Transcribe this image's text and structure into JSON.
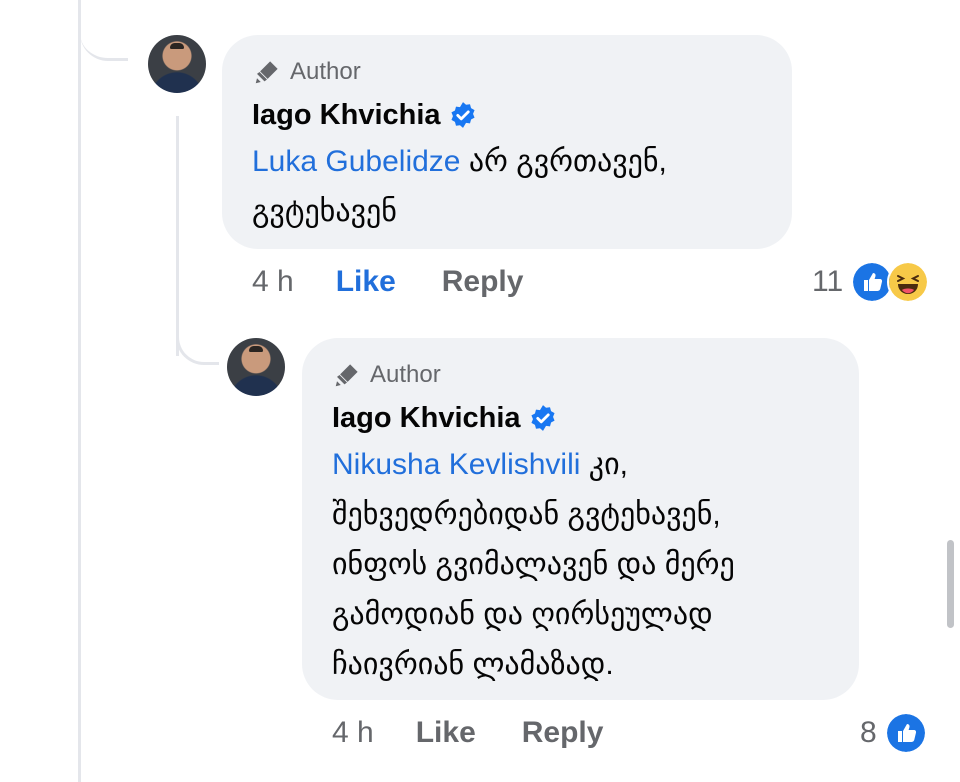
{
  "comments": [
    {
      "author_tag": "Author",
      "name": "Iago Khvichia",
      "mention": "Luka Gubelidze",
      "text_lines": [
        " არ გვრთავენ,",
        "გვტეხავენ"
      ],
      "time": "4 h",
      "like_label": "Like",
      "reply_label": "Reply",
      "reaction_count": "11",
      "reactions": [
        "like-icon",
        "haha-icon"
      ]
    },
    {
      "author_tag": "Author",
      "name": "Iago Khvichia",
      "mention": "Nikusha Kevlishvili",
      "text_lines": [
        " კი,",
        "შეხვედრებიდან გვტეხავენ,",
        "ინფოს გვიმალავენ და მერე",
        "გამოდიან და ღირსეულად",
        "ჩაივრიან ლამაზად."
      ],
      "time": "4 h",
      "like_label": "Like",
      "reply_label": "Reply",
      "reaction_count": "8",
      "reactions": [
        "like-icon"
      ]
    }
  ],
  "colors": {
    "link": "#216fdb",
    "bubble": "#f0f2f5",
    "meta": "#65676b"
  }
}
